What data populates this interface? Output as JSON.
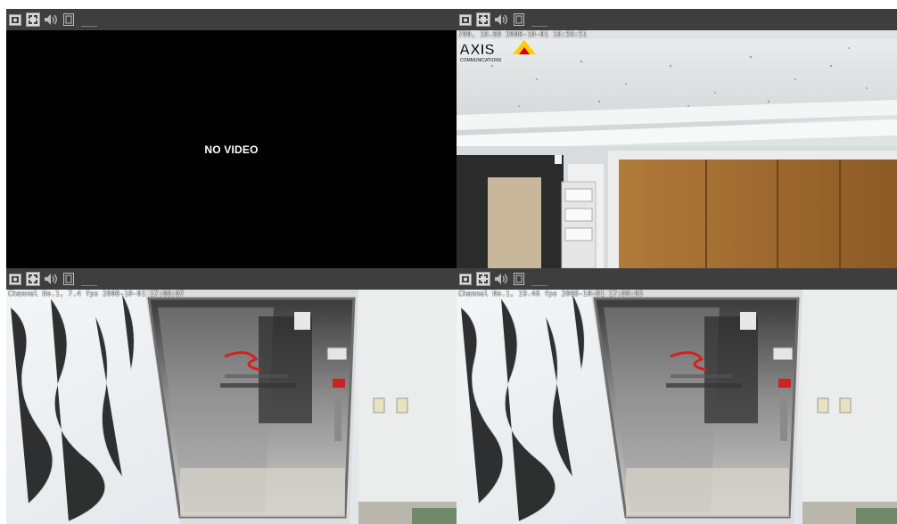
{
  "panes": [
    {
      "toolbar": {
        "icons": [
          "snapshot-icon",
          "fullscreen-icon",
          "audio-icon",
          "record-icon"
        ],
        "label": "___"
      },
      "status": "NO VIDEO",
      "osd": ""
    },
    {
      "toolbar": {
        "icons": [
          "snapshot-icon",
          "fullscreen-icon",
          "audio-icon",
          "record-icon"
        ],
        "label": "___"
      },
      "status": "",
      "osd": "700, 18.88 2008-10-01 18:59:51",
      "logo": {
        "text": "AXIS",
        "subtext": "COMMUNICATIONS",
        "accent": "#ffcc00",
        "accent_dark": "#d10000"
      }
    },
    {
      "toolbar": {
        "icons": [
          "snapshot-icon",
          "fullscreen-icon",
          "audio-icon",
          "record-icon"
        ],
        "label": "___"
      },
      "status": "",
      "osd": "Channel No.1, 7.4 fps 2008-10-01 17:00:07"
    },
    {
      "toolbar": {
        "icons": [
          "snapshot-icon",
          "fullscreen-icon",
          "audio-icon",
          "record-icon"
        ],
        "label": "___"
      },
      "status": "",
      "osd": "Channel No.1, 19.46 fps 2008-10-01 17:00:03"
    }
  ],
  "colors": {
    "toolbar_bg": "#3e3e3e",
    "video_bg": "#000000",
    "icon_fg": "#e8e8e8"
  }
}
